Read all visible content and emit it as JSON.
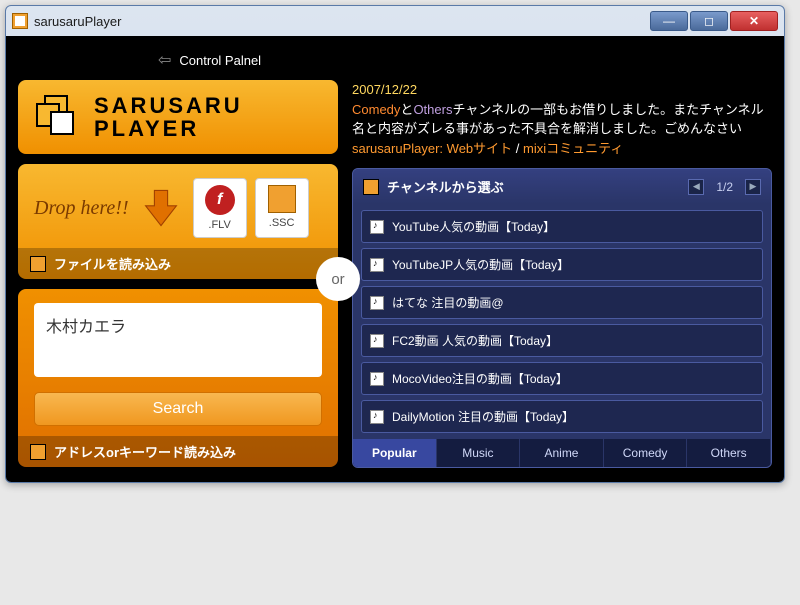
{
  "titlebar": {
    "title": "sarusaruPlayer"
  },
  "controlPanel": {
    "label": "Control Palnel"
  },
  "logo": {
    "line1": "SARUSARU",
    "line2": "PLAYER"
  },
  "drop": {
    "label": "Drop here!!",
    "flv": ".FLV",
    "ssc": ".SSC",
    "section": "ファイルを読み込み"
  },
  "or": "or",
  "search": {
    "value": "木村カエラ",
    "button": "Search",
    "section": "アドレスorキーワード読み込み"
  },
  "news": {
    "date": "2007/12/22",
    "hl1": "Comedy",
    "mid1": "と",
    "hl2": "Others",
    "body": "チャンネルの一部もお借りしました。またチャンネル名と内容がズレる事があった不具合を解消しました。ごめんなさい",
    "linkPrefix": "sarusaruPlayer:",
    "link1": "Webサイト",
    "sep": " / ",
    "link2": "mixiコミュニティ"
  },
  "channels": {
    "header": "チャンネルから選ぶ",
    "page": "1/2",
    "items": [
      {
        "label": "YouTube人気の動画【Today】"
      },
      {
        "label": "YouTubeJP人気の動画【Today】"
      },
      {
        "label": "はてな 注目の動画@"
      },
      {
        "label": "FC2動画 人気の動画【Today】"
      },
      {
        "label": "MocoVideo注目の動画【Today】"
      },
      {
        "label": "DailyMotion 注目の動画【Today】"
      }
    ]
  },
  "tabs": {
    "items": [
      {
        "label": "Popular",
        "active": true
      },
      {
        "label": "Music"
      },
      {
        "label": "Anime"
      },
      {
        "label": "Comedy"
      },
      {
        "label": "Others"
      }
    ]
  }
}
